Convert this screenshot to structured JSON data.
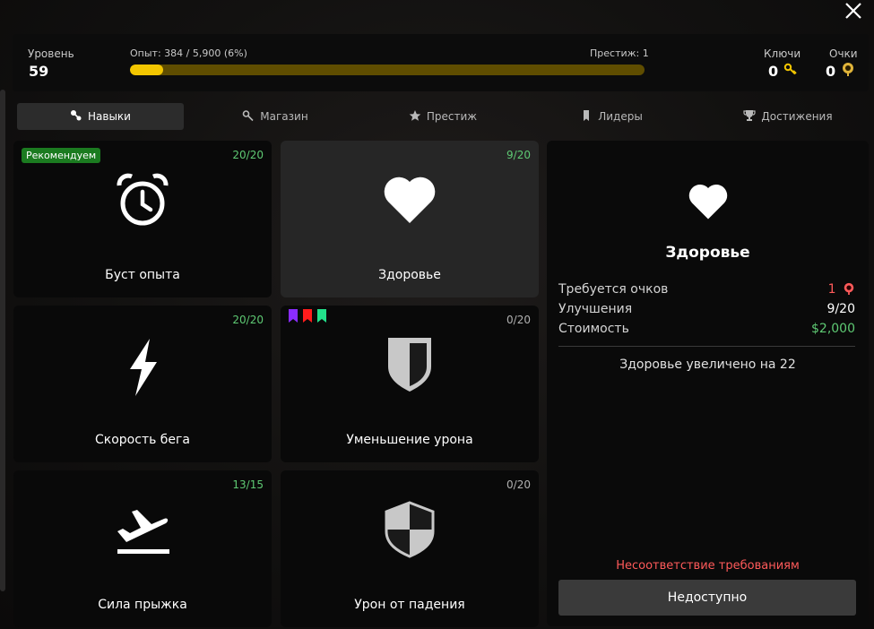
{
  "header": {
    "level_label": "Уровень",
    "level_value": "59",
    "xp_label": "Опыт: 384 / 5,900 (6%)",
    "xp_progress": 0.065,
    "prestige_label": "Престиж: 1",
    "keys_label": "Ключи",
    "keys_value": "0",
    "points_label": "Очки",
    "points_value": "0"
  },
  "tabs": [
    {
      "label": "Навыки",
      "icon": "skills-icon",
      "active": true
    },
    {
      "label": "Магазин",
      "icon": "key-icon",
      "active": false
    },
    {
      "label": "Престиж",
      "icon": "star-icon",
      "active": false
    },
    {
      "label": "Лидеры",
      "icon": "bookmark-icon",
      "active": false
    },
    {
      "label": "Достижения",
      "icon": "trophy-icon",
      "active": false
    }
  ],
  "skills": [
    {
      "title": "Буст опыта",
      "count": "20/20",
      "icon": "alarm-clock-icon",
      "badge": "Рекомендуем"
    },
    {
      "title": "Здоровье",
      "count": "9/20",
      "icon": "heart-icon",
      "selected": true
    },
    {
      "title": "Скорость бега",
      "count": "20/20",
      "icon": "lightning-icon"
    },
    {
      "title": "Уменьшение урона",
      "count": "0/20",
      "icon": "shield-half-icon",
      "flags": [
        "#8a2cff",
        "#ff1c1c",
        "#22e08a"
      ]
    },
    {
      "title": "Сила прыжка",
      "count": "13/15",
      "icon": "plane-takeoff-icon"
    },
    {
      "title": "Урон от падения",
      "count": "0/20",
      "icon": "shield-checker-icon"
    }
  ],
  "detail": {
    "icon": "heart-icon",
    "title": "Здоровье",
    "required_label": "Требуется очков",
    "required_value": "1",
    "upgrades_label": "Улучшения",
    "upgrades_value": "9/20",
    "cost_label": "Стоимость",
    "cost_value": "$2,000",
    "effect": "Здоровье увеличено на 22",
    "warning": "Несоответствие требованиям",
    "button": "Недоступно"
  },
  "colors": {
    "accent_gold": "#f3c600",
    "green": "#5ec973",
    "red": "#ff5a5a"
  }
}
